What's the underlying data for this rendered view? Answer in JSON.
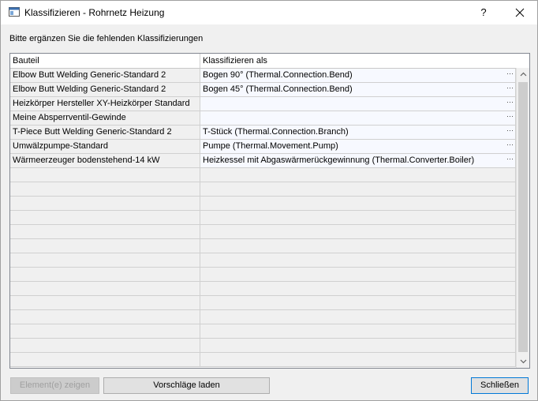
{
  "window": {
    "title": "Klassifizieren - Rohrnetz Heizung",
    "help_label": "?"
  },
  "instruction": "Bitte ergänzen Sie die fehlenden Klassifizierungen",
  "grid": {
    "columns": [
      "Bauteil",
      "Klassifizieren als"
    ],
    "rows": [
      {
        "bauteil": "Elbow Butt Welding Generic-Standard 2",
        "klass": "Bogen 90° (Thermal.Connection.Bend)"
      },
      {
        "bauteil": "Elbow Butt Welding Generic-Standard 2",
        "klass": "Bogen 45° (Thermal.Connection.Bend)"
      },
      {
        "bauteil": "Heizkörper Hersteller XY-Heizkörper Standard",
        "klass": ""
      },
      {
        "bauteil": "Meine Absperrventil-Gewinde",
        "klass": ""
      },
      {
        "bauteil": "T-Piece Butt Welding Generic-Standard 2",
        "klass": "T-Stück (Thermal.Connection.Branch)"
      },
      {
        "bauteil": "Umwälzpumpe-Standard",
        "klass": "Pumpe (Thermal.Movement.Pump)"
      },
      {
        "bauteil": "Wärmeerzeuger bodenstehend-14 kW",
        "klass": "Heizkessel mit Abgaswärmerückgewinnung (Thermal.Converter.Boiler)"
      }
    ],
    "ellipsis": "···",
    "empty_row_count": 14
  },
  "buttons": {
    "show_elements": "Element(e) zeigen",
    "load_suggestions": "Vorschläge laden",
    "close": "Schließen"
  },
  "icons": {
    "app": "dialog-icon",
    "close": "close-icon",
    "scroll_up": "chevron-up-icon",
    "scroll_down": "chevron-down-icon"
  }
}
